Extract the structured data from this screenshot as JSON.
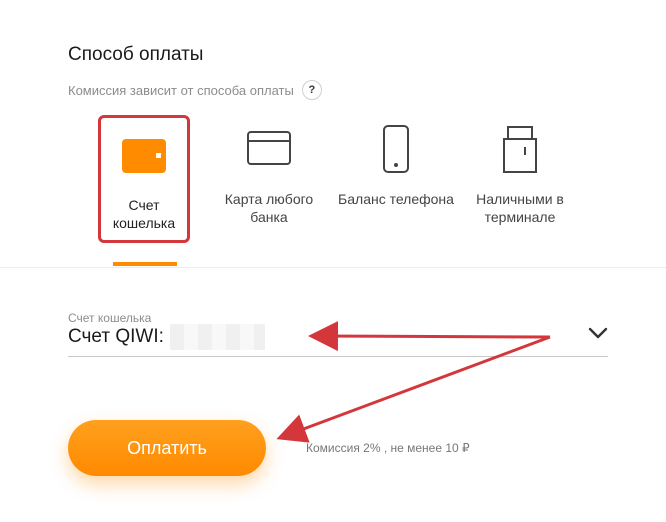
{
  "header": {
    "title": "Способ оплаты",
    "subtitle": "Комиссия зависит от способа оплаты",
    "help_icon": "?"
  },
  "methods": [
    {
      "label": "Счет кошелька",
      "icon": "wallet-icon",
      "selected": true
    },
    {
      "label": "Карта любого банка",
      "icon": "card-icon",
      "selected": false
    },
    {
      "label": "Баланс телефона",
      "icon": "phone-icon",
      "selected": false
    },
    {
      "label": "Наличными в терминале",
      "icon": "terminal-icon",
      "selected": false
    }
  ],
  "wallet_field": {
    "label": "Счет кошелька",
    "value": "Счет QIWI:"
  },
  "pay": {
    "button_label": "Оплатить",
    "commission": "Комиссия 2% , не менее 10 ₽"
  },
  "colors": {
    "accent": "#ff8c00",
    "annotation": "#d4373b"
  }
}
